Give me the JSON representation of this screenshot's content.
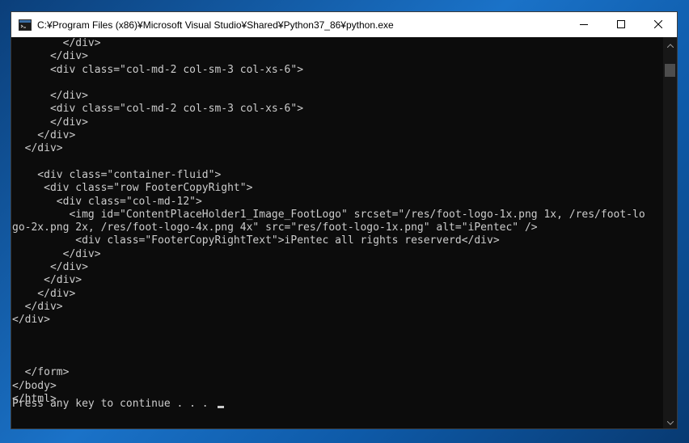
{
  "window": {
    "title": "C:¥Program Files (x86)¥Microsoft Visual Studio¥Shared¥Python37_86¥python.exe",
    "icon": "console-app-icon"
  },
  "controls": {
    "minimize": "minimize-icon",
    "maximize": "maximize-icon",
    "close": "close-icon"
  },
  "console": {
    "lines": [
      "        </div>",
      "      </div>",
      "      <div class=\"col-md-2 col-sm-3 col-xs-6\">",
      "",
      "      </div>",
      "      <div class=\"col-md-2 col-sm-3 col-xs-6\">",
      "      </div>",
      "    </div>",
      "  </div>",
      "",
      "    <div class=\"container-fluid\">",
      "     <div class=\"row FooterCopyRight\">",
      "       <div class=\"col-md-12\">",
      "         <img id=\"ContentPlaceHolder1_Image_FootLogo\" srcset=\"/res/foot-logo-1x.png 1x, /res/foot-lo",
      "go-2x.png 2x, /res/foot-logo-4x.png 4x\" src=\"res/foot-logo-1x.png\" alt=\"iPentec\" />",
      "          <div class=\"FooterCopyRightText\">iPentec all rights reserverd</div>",
      "        </div>",
      "      </div>",
      "     </div>",
      "    </div>",
      "  </div>",
      "</div>",
      "",
      "",
      "",
      "  </form>",
      "</body>",
      "</html>"
    ],
    "prompt": "Press any key to continue . . . "
  },
  "colors": {
    "console_bg": "#0c0c0c",
    "console_fg": "#cccccc",
    "titlebar_bg": "#ffffff"
  }
}
